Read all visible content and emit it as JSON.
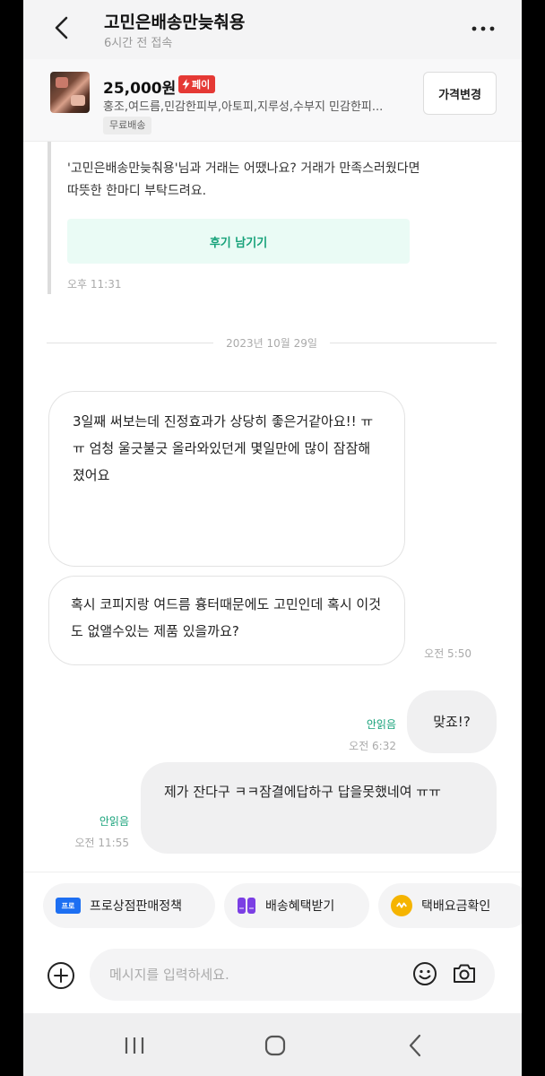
{
  "header": {
    "title": "고민은배송만늦춰용",
    "last_seen": "6시간 전 접속"
  },
  "product": {
    "price": "25,000원",
    "pay_label": "페이",
    "description": "홍조,여드름,민감한피부,아토피,지루성,수부지 민감한피...",
    "shipping_badge": "무료배송",
    "price_change_button": "가격변경"
  },
  "review_request": {
    "text": "'고민은배송만늦춰용'님과 거래는 어땠나요? 거래가 만족스러웠다면 따뜻한 한마디 부탁드려요.",
    "button": "후기 남기기",
    "time": "오후 11:31"
  },
  "date_divider": "2023년 10월 29일",
  "messages": [
    {
      "side": "left",
      "text": "3일째 써보는데 진정효과가 상당히 좋은거같아요!! ㅠㅠ 엄청 울긋불긋 올라와있던게 몇일만에 많이 잠잠해졌어요"
    },
    {
      "side": "left",
      "text": "혹시 코피지랑 여드름 흉터때문에도 고민인데 혹시 이것도 없앨수있는 제품 있을까요?",
      "time": "오전 5:50"
    },
    {
      "side": "right",
      "text": "맞죠!?",
      "status": "안읽음",
      "time": "오전 6:32"
    },
    {
      "side": "right",
      "text": "제가 잔다구 ㅋㅋ잠결에답하구 답을못했네여 ㅠㅠ",
      "status": "안읽음",
      "time": "오전 11:55"
    }
  ],
  "quick_actions": [
    {
      "label": "프로상점판매정책",
      "icon": "pro-badge-icon",
      "icon_text": "프로"
    },
    {
      "label": "배송혜택받기",
      "icon": "box-icon"
    },
    {
      "label": "택배요금확인",
      "icon": "coin-icon"
    }
  ],
  "input": {
    "placeholder": "메시지를 입력하세요.",
    "value": ""
  },
  "colors": {
    "accent_green": "#17a27a",
    "pay_red": "#e53935",
    "pro_blue": "#1d6ff2",
    "coin_yellow": "#f5b400",
    "box_purple": "#7b3fe4"
  }
}
